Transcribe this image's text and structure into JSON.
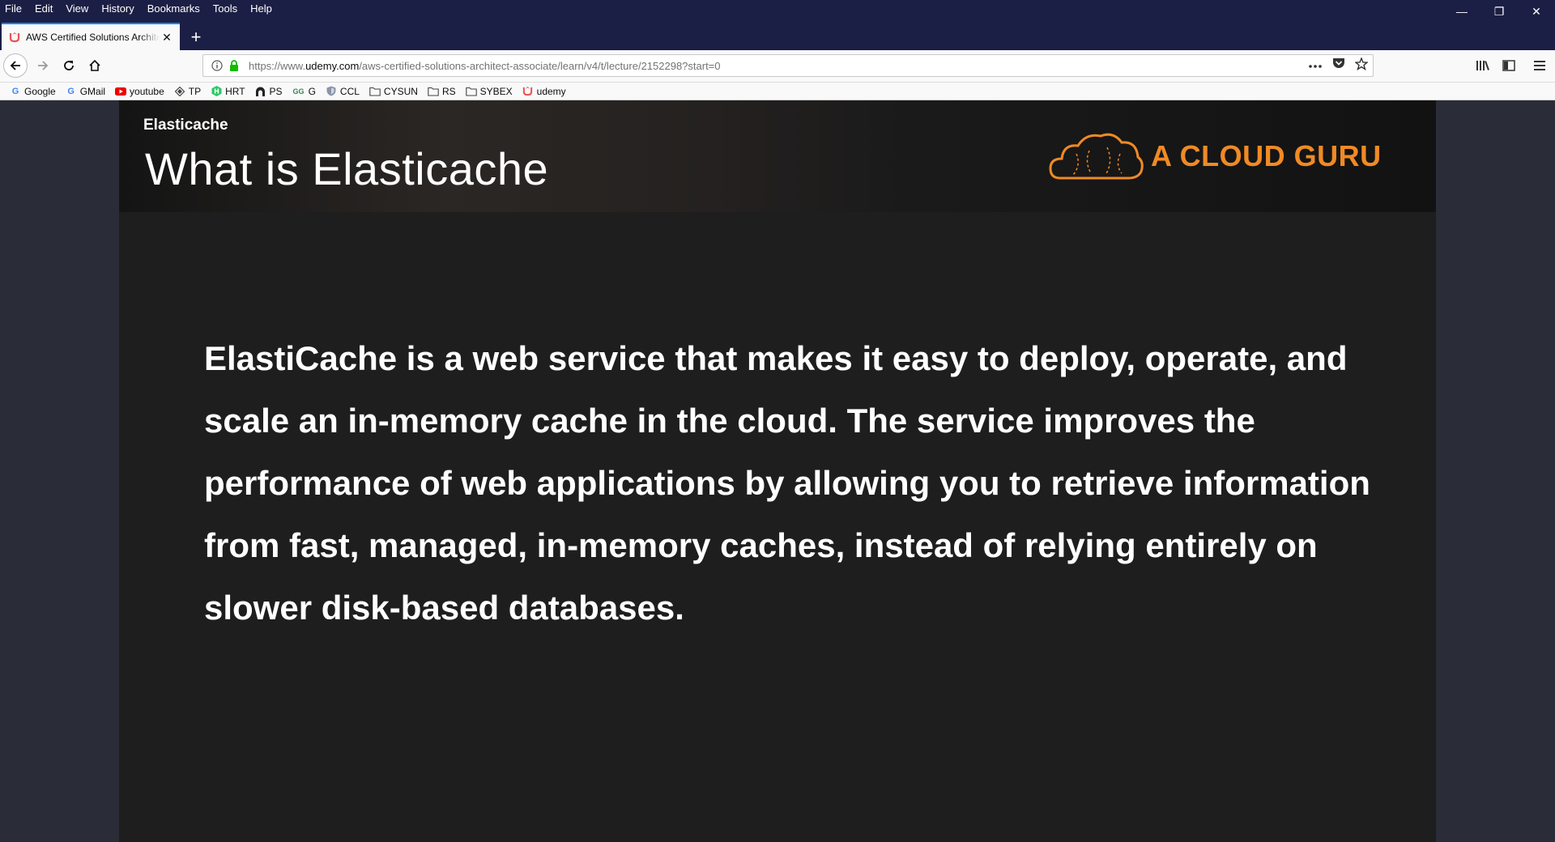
{
  "browser": {
    "menu": [
      "File",
      "Edit",
      "View",
      "History",
      "Bookmarks",
      "Tools",
      "Help"
    ],
    "window_controls": {
      "minimize": "—",
      "restore": "❐",
      "close": "✕"
    },
    "tab": {
      "title": "AWS Certified Solutions Architect - Associate | Udemy",
      "close": "✕"
    },
    "new_tab": "+",
    "url": {
      "prefix": "https://www.",
      "domain": "udemy.com",
      "path": "/aws-certified-solutions-architect-associate/learn/v4/t/lecture/2152298?start=0"
    },
    "bookmarks": [
      {
        "label": "Google",
        "icon": "google-icon"
      },
      {
        "label": "GMail",
        "icon": "google-icon"
      },
      {
        "label": "youtube",
        "icon": "youtube-icon"
      },
      {
        "label": "TP",
        "icon": "diamond-icon"
      },
      {
        "label": "HRT",
        "icon": "hackerrank-icon"
      },
      {
        "label": "PS",
        "icon": "arch-icon"
      },
      {
        "label": "G",
        "icon": "gfg-icon"
      },
      {
        "label": "CCL",
        "icon": "shield-icon"
      },
      {
        "label": "CYSUN",
        "icon": "folder-icon"
      },
      {
        "label": "RS",
        "icon": "folder-icon"
      },
      {
        "label": "SYBEX",
        "icon": "folder-icon"
      },
      {
        "label": "udemy",
        "icon": "udemy-icon"
      }
    ],
    "colors": {
      "titlebar": "#1c1f45",
      "accent": "#0a84ff"
    }
  },
  "slide": {
    "section": "Elasticache",
    "title": "What is Elasticache",
    "logo_text": "A CLOUD GURU",
    "body": "ElastiCache is a web service that makes it easy to deploy, operate, and scale an in-memory cache in the cloud. The service improves the performance of web applications by allowing you to retrieve information from fast, managed, in-memory caches, instead of relying entirely on slower disk-based databases.",
    "colors": {
      "logo": "#f08a24",
      "background": "#1e1e1e"
    }
  }
}
